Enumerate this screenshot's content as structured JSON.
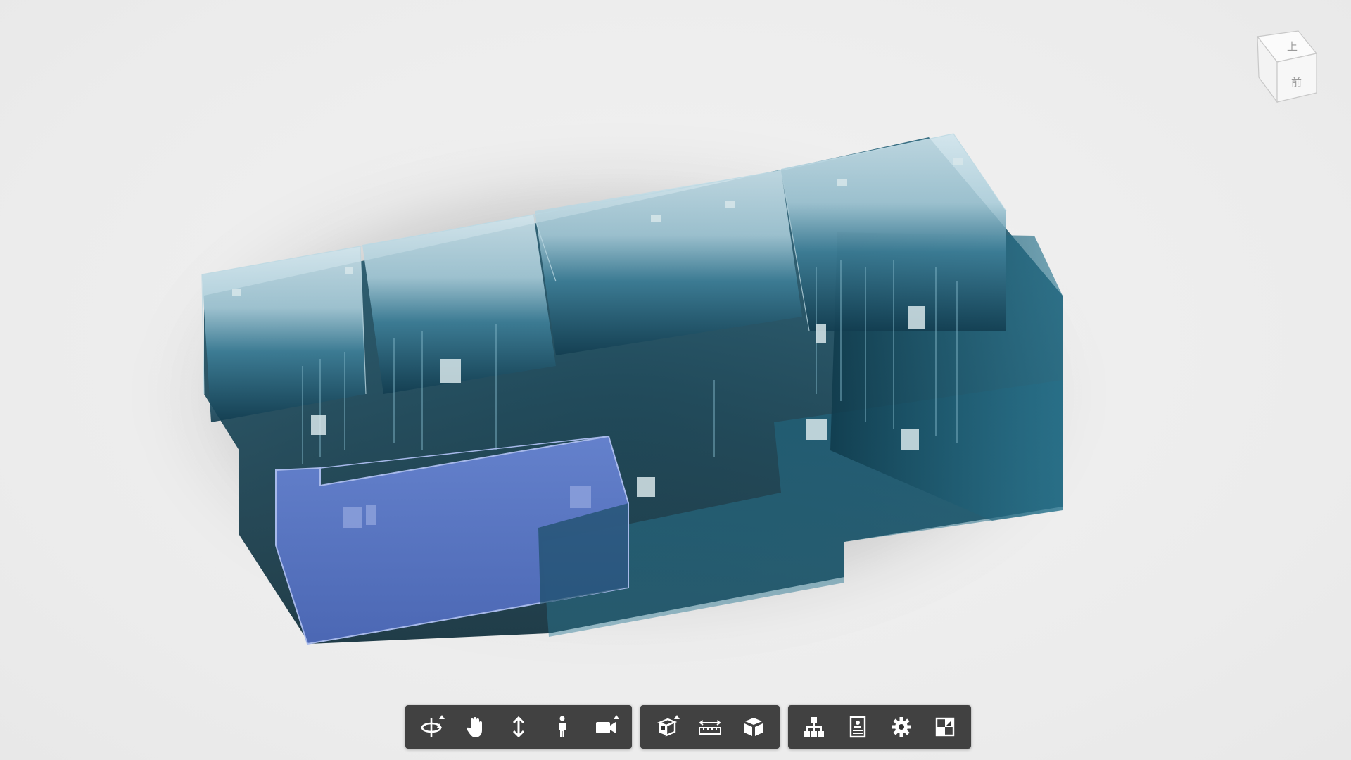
{
  "view_cube": {
    "top_face_label": "上",
    "front_face_label": "前"
  },
  "toolbar": {
    "groups": [
      {
        "name": "navigation",
        "tools": [
          {
            "icon": "orbit-icon",
            "has_submenu": true
          },
          {
            "icon": "pan-hand-icon",
            "has_submenu": false
          },
          {
            "icon": "zoom-vertical-arrows-icon",
            "has_submenu": false
          },
          {
            "icon": "first-person-walk-icon",
            "has_submenu": false
          },
          {
            "icon": "camera-icon",
            "has_submenu": true
          }
        ]
      },
      {
        "name": "analysis",
        "tools": [
          {
            "icon": "section-box-icon",
            "has_submenu": true
          },
          {
            "icon": "measure-ruler-icon",
            "has_submenu": false
          },
          {
            "icon": "explode-cube-icon",
            "has_submenu": false
          }
        ]
      },
      {
        "name": "panels",
        "tools": [
          {
            "icon": "model-tree-icon",
            "has_submenu": false
          },
          {
            "icon": "properties-icon",
            "has_submenu": false
          },
          {
            "icon": "settings-gear-icon",
            "has_submenu": false
          },
          {
            "icon": "fullscreen-icon",
            "has_submenu": false
          }
        ]
      }
    ]
  },
  "colors": {
    "background": "#eeeeee",
    "model_light": "#c6dde6",
    "model_mid": "#2f6e86",
    "model_dark": "#0c2f3e",
    "selection": "#5b78c9",
    "toolbar_bg": "#323232",
    "icon": "#ffffff"
  }
}
